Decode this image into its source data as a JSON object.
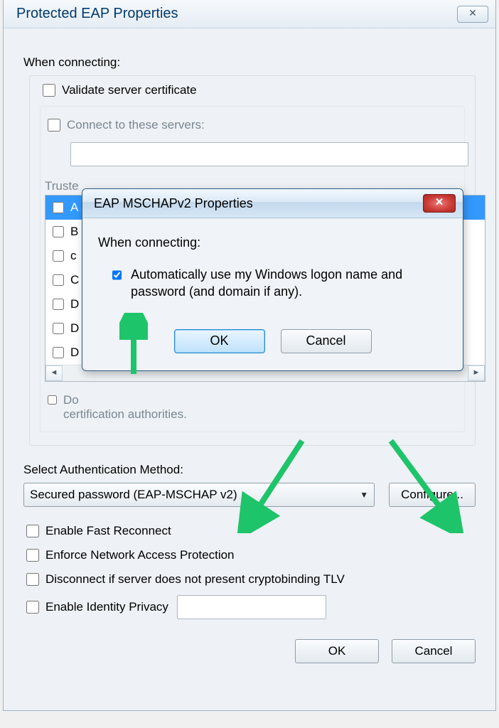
{
  "window": {
    "title": "Protected EAP Properties",
    "close_glyph": "✕"
  },
  "connecting_label": "When connecting:",
  "validate_cert_label": "Validate server certificate",
  "connect_servers": {
    "label": "Connect to these servers:",
    "value": ""
  },
  "trusted_label_visible": "Truste",
  "trusted_items": [
    "A",
    "B",
    "c",
    "C",
    "D",
    "D",
    "D"
  ],
  "dont_prompt_visible_prefix": "Do",
  "dont_prompt_rest": "certification authorities.",
  "auth_method_label": "Select Authentication Method:",
  "auth_method_value": "Secured password (EAP-MSCHAP v2)",
  "configure_label": "Configure...",
  "options": {
    "fast_reconnect": "Enable Fast Reconnect",
    "nap": "Enforce Network Access Protection",
    "cryptobinding": "Disconnect if server does not present cryptobinding TLV",
    "identity_privacy": "Enable Identity Privacy",
    "identity_value": ""
  },
  "footer": {
    "ok": "OK",
    "cancel": "Cancel"
  },
  "modal": {
    "title": "EAP MSCHAPv2 Properties",
    "close_glyph": "✕",
    "when_connecting": "When connecting:",
    "auto_logon": "Automatically use my Windows logon name and password (and domain if any).",
    "ok": "OK",
    "cancel": "Cancel"
  },
  "arrow_color": "#1EC46A"
}
